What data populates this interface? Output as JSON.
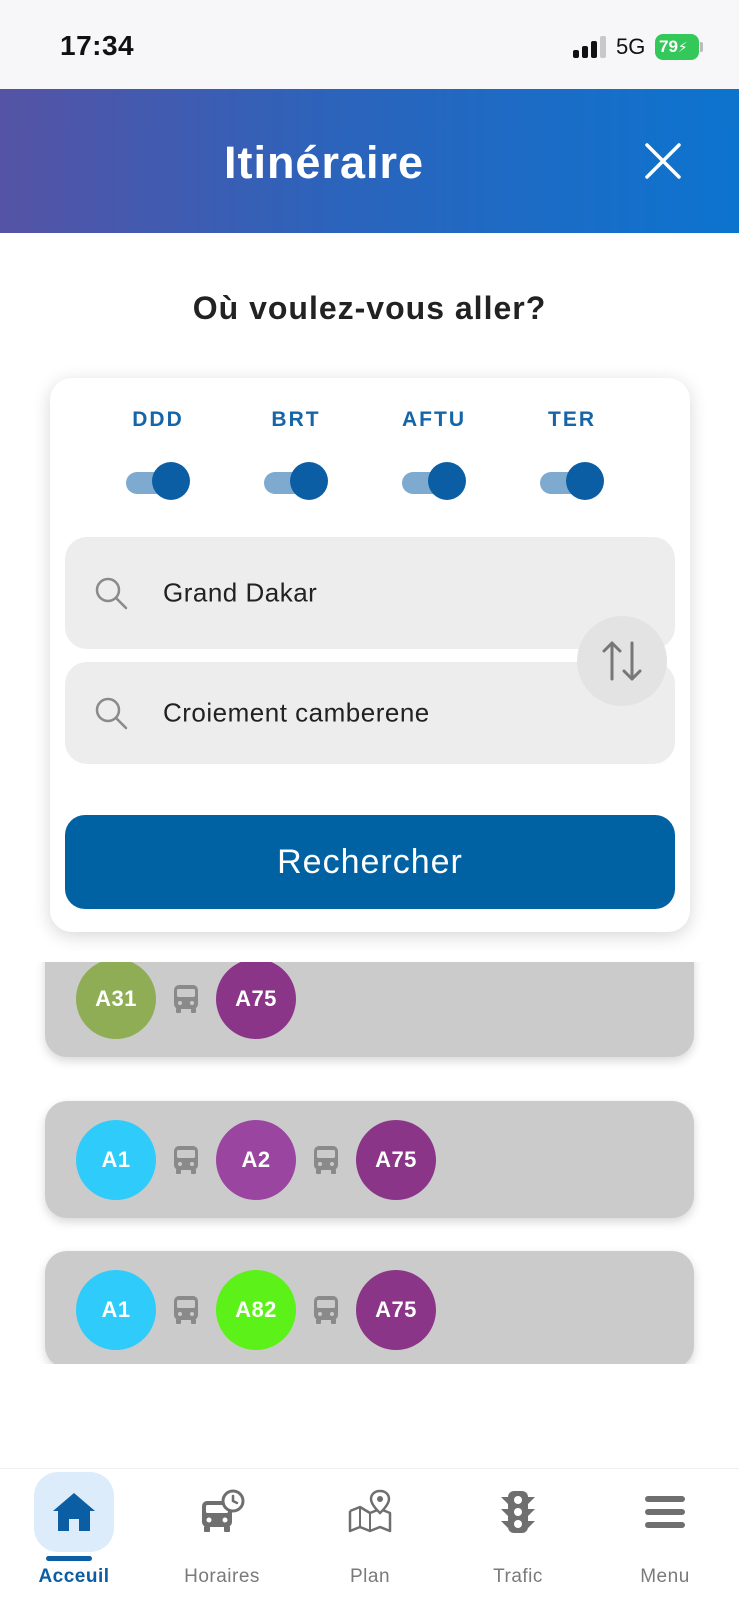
{
  "status_bar": {
    "time": "17:34",
    "network": "5G",
    "battery": "79"
  },
  "header": {
    "title": "Itinéraire",
    "close_icon": "close-icon"
  },
  "prompt": "Où voulez-vous aller?",
  "search": {
    "operators": [
      {
        "label": "DDD",
        "enabled": true
      },
      {
        "label": "BRT",
        "enabled": true
      },
      {
        "label": "AFTU",
        "enabled": true
      },
      {
        "label": "TER",
        "enabled": true
      }
    ],
    "from": "Grand Dakar",
    "to": "Croiement camberene",
    "submit_label": "Rechercher",
    "colors": {
      "accent": "#0061a3",
      "toggle_knob": "#0b5ea3",
      "toggle_track": "#7eaad0"
    }
  },
  "results": [
    {
      "lines": [
        {
          "label": "A31",
          "color": "#8fad55"
        },
        {
          "label": "A75",
          "color": "#8a3587"
        }
      ]
    },
    {
      "lines": [
        {
          "label": "A1",
          "color": "#2ecbfb"
        },
        {
          "label": "A2",
          "color": "#9a46a1"
        },
        {
          "label": "A75",
          "color": "#8a3587"
        }
      ]
    },
    {
      "lines": [
        {
          "label": "A1",
          "color": "#2ecbfb"
        },
        {
          "label": "A82",
          "color": "#5cf118"
        },
        {
          "label": "A75",
          "color": "#8a3587"
        }
      ]
    }
  ],
  "bottom_nav": [
    {
      "label": "Acceuil",
      "icon": "home-icon",
      "active": true
    },
    {
      "label": "Horaires",
      "icon": "bus-clock-icon",
      "active": false
    },
    {
      "label": "Plan",
      "icon": "map-pin-icon",
      "active": false
    },
    {
      "label": "Trafic",
      "icon": "traffic-light-icon",
      "active": false
    },
    {
      "label": "Menu",
      "icon": "menu-icon",
      "active": false
    }
  ]
}
